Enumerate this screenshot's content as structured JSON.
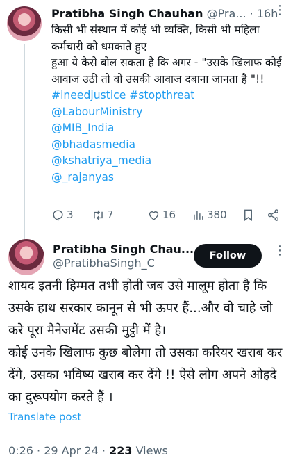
{
  "reply_tweet": {
    "name": "Pratibha Singh Chauhan",
    "handle": "@Pra...",
    "separator": "·",
    "time": "16h",
    "more": "⋮",
    "text_lines": [
      "किसी भी संस्थान में कोई भी व्यक्ति, किसी भी महिला कर्मचारी को धमकाते हुए",
      "हुआ ये कैसे बोल सकता है कि अगर - \"उसके खिलाफ कोई आवाज उठी तो वो उसकी आवाज दबाना जानता है \"!!"
    ],
    "hashtags": "#ineedjustice #stopthreat",
    "mentions": [
      "@LabourMinistry",
      "@MIB_India",
      "@bhadasmedia",
      "@kshatriya_media",
      "@_rajanyas"
    ],
    "actions": {
      "replies": "3",
      "retweets": "7",
      "likes": "16",
      "views": "380"
    }
  },
  "main_tweet": {
    "name": "Pratibha Singh Chau...",
    "handle": "@PratibhaSingh_C",
    "follow_label": "Follow",
    "more": "⋮",
    "text": "शायद इतनी हिम्मत तभी होती जब उसे मालूम होता है कि उसके हाथ सरकार कानून से भी ऊपर हैं...और वो चाहे जो करे पूरा मैनेजमेंट उसकी मुट्ठी में है।\nकोई उनके खिलाफ कुछ बोलेगा तो उसका करियर खराब कर देंगे, उसका भविष्य खराब कर देंगे !! ऐसे लोग अपने ओहदे का दुरूपयोग करते हैं ।",
    "translate_label": "Translate post",
    "time": "0:26",
    "date": "29 Apr 24",
    "separator": "·",
    "views_count": "223",
    "views_label": "Views"
  },
  "colors": {
    "accent": "#1d9bf0",
    "text": "#0f1419",
    "secondary": "#536471",
    "button_bg": "#0f1419"
  },
  "icons": [
    "reply-icon",
    "retweet-icon",
    "like-icon",
    "views-icon",
    "bookmark-icon",
    "share-icon",
    "more-icon"
  ]
}
